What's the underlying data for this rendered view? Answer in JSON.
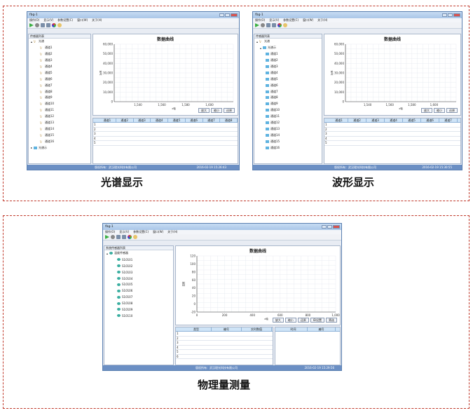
{
  "captions": {
    "spectrum": "光谱显示",
    "waveform": "波形显示",
    "physical": "物理量测量"
  },
  "app": {
    "title": "fbg-1",
    "menu": [
      "操作(O)",
      "显示(V)",
      "参数设置(C)",
      "窗口(W)",
      "关于(H)"
    ],
    "toolbar_icons": [
      "play-icon",
      "stop-icon",
      "save-icon",
      "save-as-icon",
      "color-icon",
      "settings-icon"
    ],
    "status_company": "版权所有：武汉理光科技有限公司"
  },
  "spectrum_window": {
    "tree_header": "传感器列表",
    "tree_root": "光谱",
    "tree_items": [
      "通道1",
      "通道2",
      "通道3",
      "通道4",
      "通道5",
      "通道6",
      "通道7",
      "通道8",
      "通道9",
      "通道10",
      "通道11",
      "通道12",
      "通道13",
      "通道14",
      "通道15",
      "通道16"
    ],
    "tree_root2": "光谱示",
    "chart_title": "数据曲线",
    "buttons": [
      "放大",
      "缩小",
      "还原"
    ],
    "table_columns": [
      "通道1",
      "通道2",
      "通道3",
      "通道4",
      "通道5",
      "通道6",
      "通道7",
      "通道8"
    ],
    "row_numbers": [
      "1",
      "2",
      "3",
      "4",
      "5"
    ],
    "timestamp": "2016-02-19 15:26:43",
    "ylabel": "功率",
    "xlabel": "x轴"
  },
  "waveform_window": {
    "tree_header": "传感器列表",
    "tree_root": "光谱",
    "tree_root_sub": "光谱示",
    "tree_items": [
      "通道1",
      "通道2",
      "通道3",
      "通道4",
      "通道5",
      "通道6",
      "通道7",
      "通道8",
      "通道9",
      "通道10",
      "通道11",
      "通道12",
      "通道13",
      "通道14",
      "通道15",
      "通道16"
    ],
    "chart_title": "数据曲线",
    "buttons": [
      "放大",
      "缩小",
      "还原"
    ],
    "table_columns": [
      "通道1",
      "通道2",
      "通道3",
      "通道4",
      "通道5",
      "通道6",
      "通道7"
    ],
    "row_numbers": [
      "1",
      "2",
      "3",
      "4",
      "5"
    ],
    "timestamp": "2016-02-19 15:30:55",
    "ylabel": "功率",
    "xlabel": "x轴"
  },
  "physical_window": {
    "tree_header": "系统传感器列表",
    "tree_root": "温度传感器",
    "tree_items": [
      "S10101",
      "S10102",
      "S10103",
      "S10104",
      "S10105",
      "S10106",
      "S10107",
      "S10108",
      "S10109",
      "S10110"
    ],
    "chart_title": "数据曲线",
    "buttons": [
      "放大",
      "缩小",
      "还原",
      "ID设置",
      "筛选"
    ],
    "table_columns": [
      "类型",
      "编号",
      "实时数值"
    ],
    "table2_columns": [
      "时间",
      "编号"
    ],
    "row_numbers": [
      "1",
      "2",
      "3",
      "4",
      "5",
      "6"
    ],
    "timestamp": "2016-02-19 15:29:56",
    "ylabel": "温度",
    "xlabel": "x轴"
  },
  "chart_data": [
    {
      "type": "line",
      "title": "数据曲线",
      "xlabel": "x轴",
      "ylabel": "功率",
      "xlim": [
        1520,
        1620
      ],
      "ylim": [
        0,
        60000
      ],
      "xticks": [
        1540,
        1560,
        1580,
        1600
      ],
      "yticks": [
        0,
        10000,
        20000,
        30000,
        40000,
        50000,
        60000
      ],
      "grid": true,
      "series": []
    },
    {
      "type": "line",
      "title": "数据曲线",
      "xlabel": "x轴",
      "ylabel": "功率",
      "xlim": [
        1520,
        1620
      ],
      "ylim": [
        0,
        60000
      ],
      "xticks": [
        1540,
        1560,
        1580,
        1600
      ],
      "yticks": [
        0,
        10000,
        20000,
        30000,
        40000,
        50000,
        60000
      ],
      "grid": true,
      "series": []
    },
    {
      "type": "line",
      "title": "数据曲线",
      "xlabel": "x轴",
      "ylabel": "温度",
      "xlim": [
        0,
        1000
      ],
      "ylim": [
        -20,
        120
      ],
      "xticks": [
        0,
        200,
        400,
        600,
        800,
        1000
      ],
      "yticks": [
        -20,
        0,
        20,
        40,
        60,
        80,
        100,
        120
      ],
      "grid": true,
      "series": []
    }
  ],
  "colors": {
    "frame_border": "#c0392b",
    "titlebar": "#b6d0ee",
    "statusbar": "#6b8fc4",
    "table_header": "#cfe4f7"
  }
}
